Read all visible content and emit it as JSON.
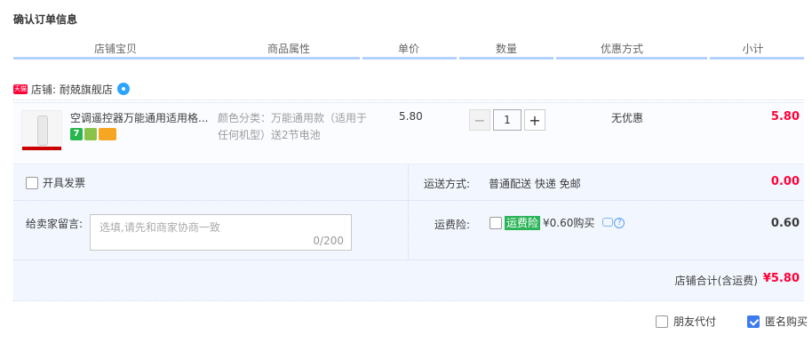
{
  "page": {
    "title": "确认订单信息"
  },
  "columns": [
    "店铺宝贝",
    "商品属性",
    "单价",
    "数量",
    "优惠方式",
    "小计"
  ],
  "shop": {
    "label": "店铺: 耐兢旗舰店",
    "tmall_badge": "天猫"
  },
  "item": {
    "title": "空调遥控器万能通用适用格...",
    "badge_1": "7",
    "attribute": "颜色分类：万能通用款（适用于任何机型）送2节电池",
    "price": "5.80",
    "quantity": "1",
    "minus": "−",
    "plus": "+",
    "discount": "无优惠",
    "subtotal": "5.80"
  },
  "invoice": {
    "label": "开具发票",
    "checked": false
  },
  "message": {
    "label": "给卖家留言:",
    "placeholder": "选填,请先和商家协商一致",
    "count": "0/200"
  },
  "shipping": {
    "label": "运送方式:",
    "value": "普通配送 快递 免邮",
    "fee": "0.00"
  },
  "insurance": {
    "label": "运费险:",
    "tag": "运费险",
    "price_text": "¥0.60购买",
    "fee": "0.60",
    "help": "?"
  },
  "total": {
    "label": "店铺合计(含运费)",
    "value": "¥5.80"
  },
  "options": {
    "friend_pay": "朋友代付",
    "anonymous": "匿名购买",
    "friend_checked": false,
    "anonymous_checked": true
  }
}
